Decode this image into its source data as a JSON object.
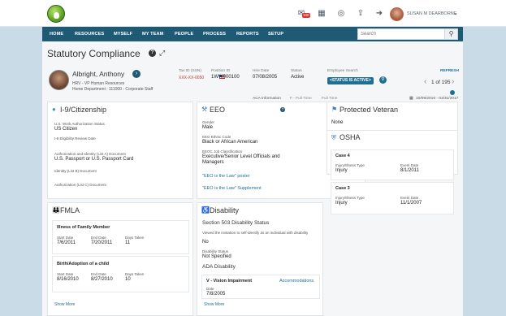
{
  "topbar": {
    "icons": [
      "mail-icon",
      "calendar-icon",
      "chat-icon",
      "share-icon",
      "exit-icon",
      "help-icon"
    ],
    "mail_badge": "100",
    "user_name": "SUSAN M DEARBORNE"
  },
  "nav": {
    "items": [
      "HOME",
      "RESOURCES",
      "MYSELF",
      "MY TEAM",
      "PEOPLE",
      "PROCESS",
      "REPORTS",
      "SETUP"
    ],
    "search_placeholder": "Search"
  },
  "page": {
    "title": "Statutory Compliance"
  },
  "employee": {
    "name": "Albright, Anthony",
    "line1": "HRV - VP Human Resources",
    "line2": "Home Department : 111000 - Corporate Staff",
    "tax_label": "Tax ID (SSN)",
    "tax_value": "XXX-XX-0050",
    "position_label": "Position ID",
    "position_value": "1WW000100",
    "hire_label": "Hire Date",
    "hire_value": "07/08/2005",
    "status_label": "Status",
    "status_value": "Active",
    "search_label": "Employee Search",
    "status_pill": "<STATUS IS ACTIVE>",
    "refresh": "REFRESH",
    "pager": "1 of 195"
  },
  "aca": {
    "label": "ACA Information",
    "mark1": "F - Full Time",
    "mark2": "Full Time",
    "dates": "10/09/2016 - 03/31/2017"
  },
  "i9": {
    "title": "I-9/Citizenship",
    "fields": [
      {
        "label": "U.S. Work Authorization Status",
        "value": "US Citizen"
      },
      {
        "label": "I-9 Eligibility Review Date",
        "value": ""
      },
      {
        "label": "Authorization and Identity (List A) Document",
        "value": "U.S. Passport or U.S. Passport Card"
      },
      {
        "label": "Identity (List B) Document",
        "value": ""
      },
      {
        "label": "Authorization (List C) Document",
        "value": ""
      }
    ]
  },
  "eeo": {
    "title": "EEO",
    "fields": [
      {
        "label": "Gender",
        "value": "Male"
      },
      {
        "label": "EEO Ethnic Code",
        "value": "Black or African American"
      },
      {
        "label": "EEOC Job Classification",
        "value": "Executive/Senior Level Officials and Managers"
      }
    ],
    "link1": "\"EEO is the Law\" poster",
    "link2": "\"EEO is the Law\" Supplement"
  },
  "veteran": {
    "title": "Protected Veteran",
    "value": "None"
  },
  "osha": {
    "title": "OSHA",
    "cases": [
      {
        "title": "Case 4",
        "type_label": "Injury/Illness Type",
        "type": "Injury",
        "date_label": "Event Date",
        "date": "8/1/2011"
      },
      {
        "title": "Case 3",
        "type_label": "Injury/Illness Type",
        "type": "Injury",
        "date_label": "Event Date",
        "date": "11/1/2007"
      }
    ]
  },
  "fmla": {
    "title": "FMLA",
    "entries": [
      {
        "title": "Illness of Family Member",
        "start_label": "Start Date",
        "start": "7/6/2011",
        "end_label": "End Date",
        "end": "7/20/2011",
        "days_label": "Days Taken",
        "days": "11"
      },
      {
        "title": "Birth/Adoption of a child",
        "start_label": "Start Date",
        "start": "8/16/2010",
        "end_label": "End Date",
        "end": "8/27/2010",
        "days_label": "Days Taken",
        "days": "10"
      }
    ],
    "show_more": "Show More"
  },
  "disability": {
    "title": "Disability",
    "section": "Section 503 Disability Status",
    "invite_label": "Viewed the invitation to self-identify as an individual with disability",
    "invite_value": "No",
    "status_label": "Disability Status",
    "status_value": "Not Specified",
    "ada": "ADA Disability",
    "impairment": "V - Vision Impairment",
    "accommodations": "Accommodations",
    "date_label": "Date",
    "date": "7/8/2005",
    "show_more": "Show More"
  }
}
